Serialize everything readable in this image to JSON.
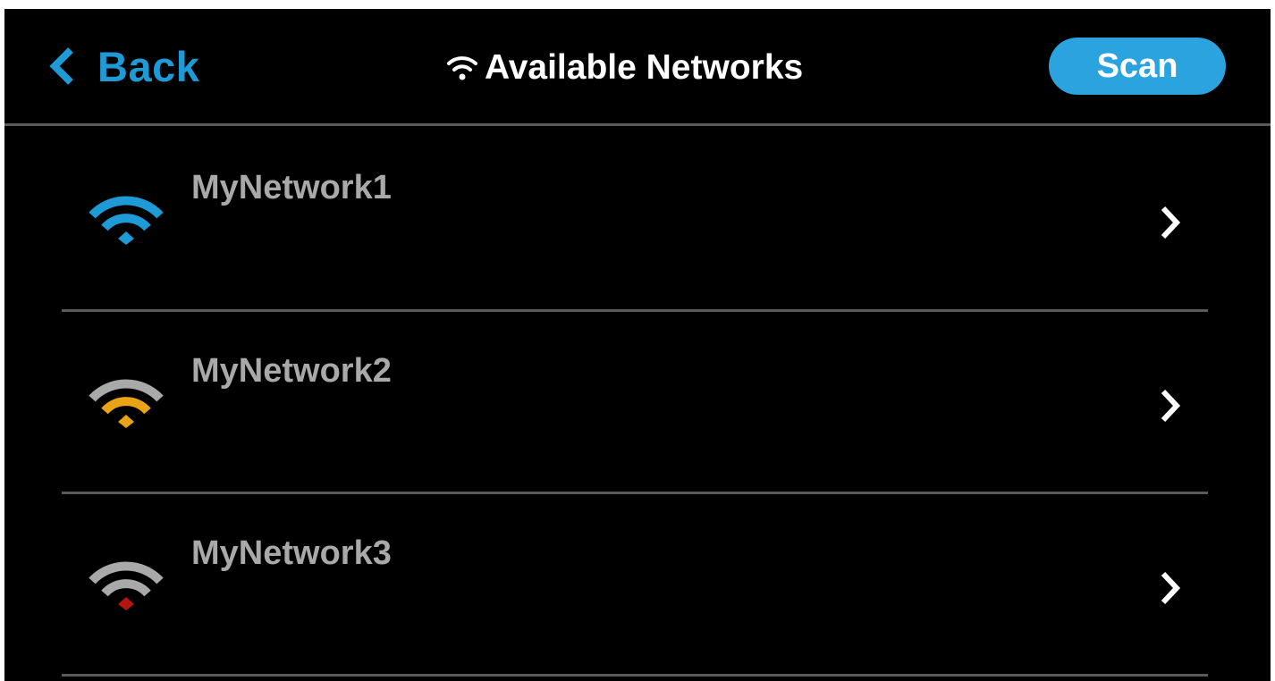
{
  "header": {
    "back_label": "Back",
    "title": "Available Networks",
    "scan_label": "Scan"
  },
  "networks": [
    {
      "name": "MyNetwork1",
      "signal_color": "#1e9ad6",
      "signal_level": "strong"
    },
    {
      "name": "MyNetwork2",
      "signal_color": "#e8a317",
      "signal_level": "medium"
    },
    {
      "name": "MyNetwork3",
      "signal_color": "#b3160f",
      "signal_level": "weak"
    }
  ],
  "colors": {
    "background": "#000000",
    "accent": "#1e9ad6",
    "scan_button": "#2aa3de",
    "inactive_signal": "#a9a9a9",
    "divider": "#5a5a5a"
  },
  "icons": {
    "back": "chevron-left-icon",
    "title": "wifi-icon",
    "row_arrow": "chevron-right-icon"
  }
}
